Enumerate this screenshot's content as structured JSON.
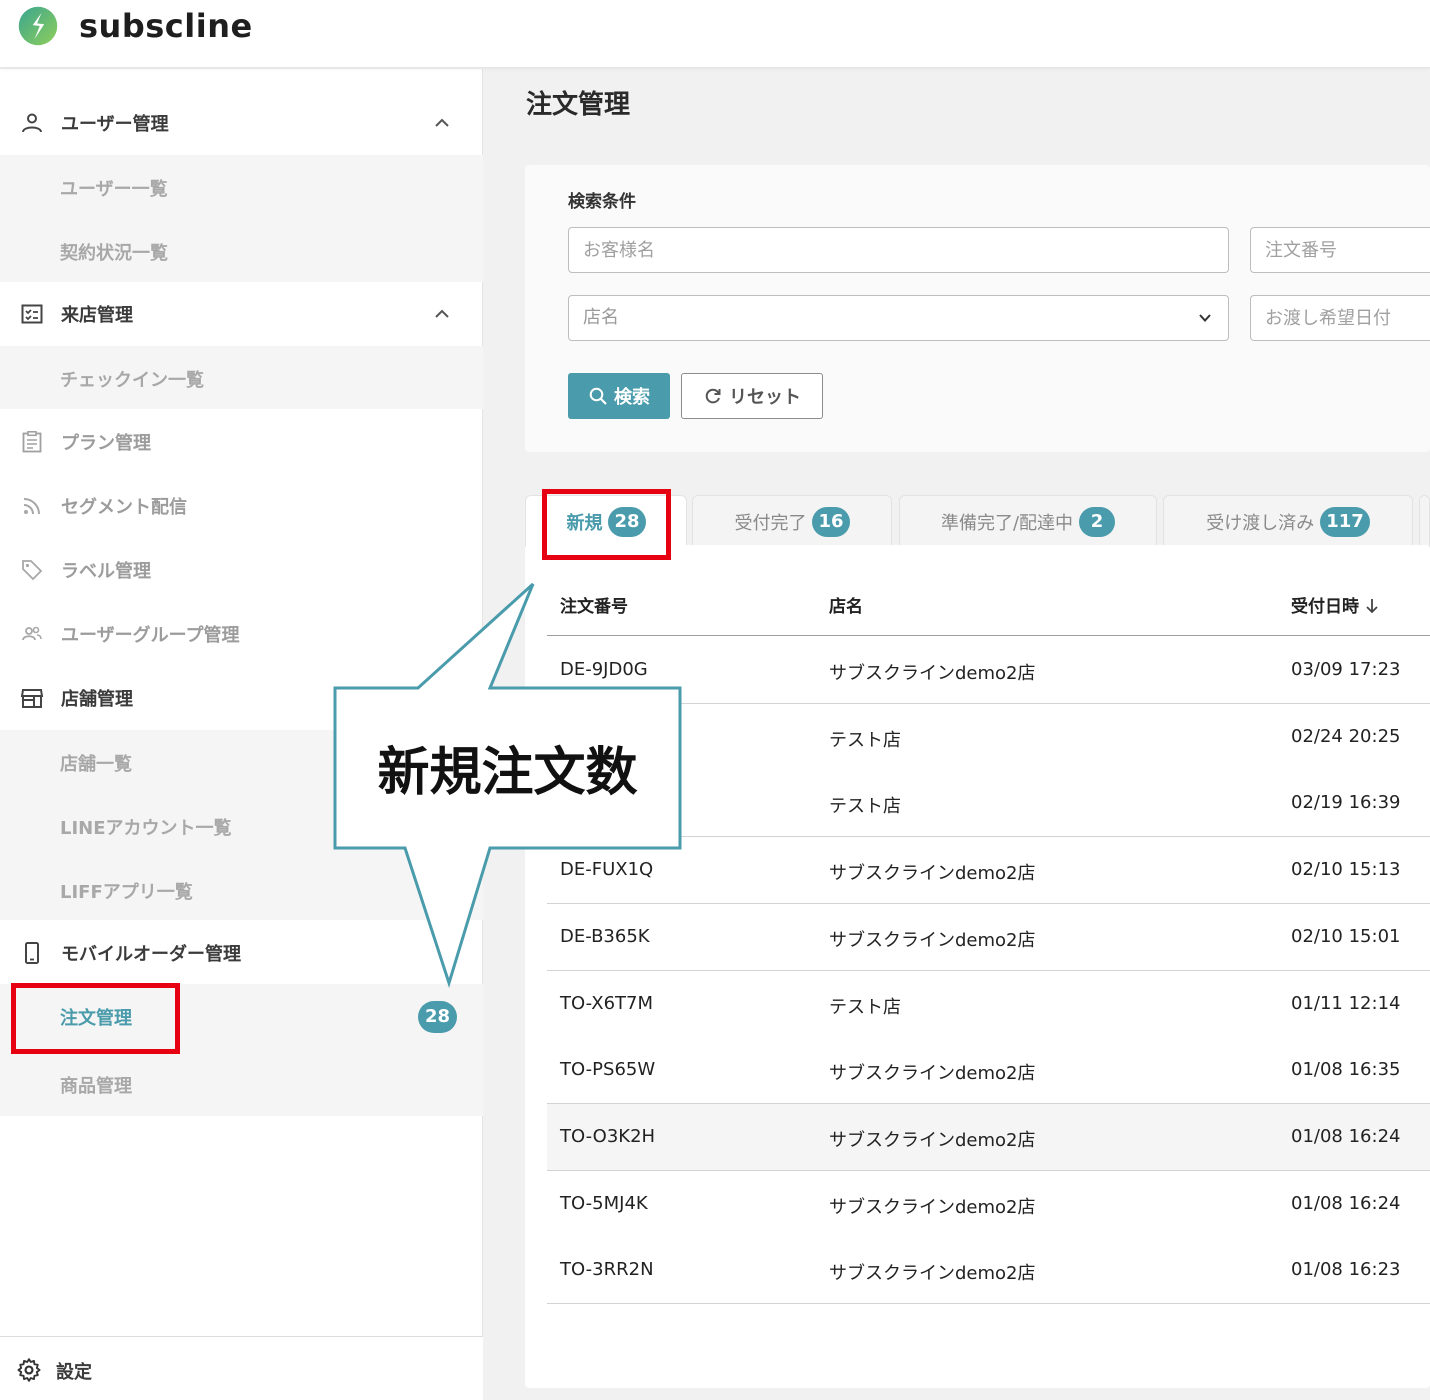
{
  "app": {
    "brand": "subscline",
    "accent_color": "#4a9bab",
    "annotation_color": "#e60012"
  },
  "sidebar": {
    "groups": [
      {
        "label": "ユーザー管理",
        "icon": "person-icon",
        "expanded": true,
        "children": [
          {
            "label": "ユーザー一覧"
          },
          {
            "label": "契約状況一覧"
          }
        ]
      },
      {
        "label": "来店管理",
        "icon": "checklist-icon",
        "expanded": true,
        "children": [
          {
            "label": "チェックイン一覧"
          }
        ]
      },
      {
        "label": "プラン管理",
        "icon": "clipboard-icon"
      },
      {
        "label": "セグメント配信",
        "icon": "rss-icon"
      },
      {
        "label": "ラベル管理",
        "icon": "tag-icon"
      },
      {
        "label": "ユーザーグループ管理",
        "icon": "group-icon"
      },
      {
        "label": "店舗管理",
        "icon": "store-icon",
        "children": [
          {
            "label": "店舗一覧"
          },
          {
            "label": "LINEアカウント一覧"
          },
          {
            "label": "LIFFアプリ一覧"
          }
        ]
      },
      {
        "label": "モバイルオーダー管理",
        "icon": "mobile-icon",
        "children": [
          {
            "label": "注文管理",
            "badge": "28",
            "active": true
          },
          {
            "label": "商品管理"
          }
        ]
      }
    ],
    "footer": {
      "label": "設定",
      "icon": "gear-icon"
    }
  },
  "main": {
    "title": "注文管理",
    "search": {
      "heading": "検索条件",
      "customer_placeholder": "お客様名",
      "order_no_placeholder": "注文番号",
      "store_select_value": "店名",
      "date_placeholder": "お渡し希望日付",
      "search_label": "検索",
      "reset_label": "リセット"
    },
    "tabs": [
      {
        "label": "新規",
        "count": "28",
        "active": true
      },
      {
        "label": "受付完了",
        "count": "16"
      },
      {
        "label": "準備完了/配達中",
        "count": "2"
      },
      {
        "label": "受け渡し済み",
        "count": "117"
      }
    ],
    "table": {
      "columns": [
        "注文番号",
        "店名",
        "受付日時"
      ],
      "rows": [
        [
          "DE-9JD0G",
          "サブスクラインdemo2店",
          "03/09 17:23"
        ],
        [
          "",
          "テスト店",
          "02/24 20:25"
        ],
        [
          "",
          "テスト店",
          "02/19 16:39"
        ],
        [
          "DE-FUX1Q",
          "サブスクラインdemo2店",
          "02/10 15:13"
        ],
        [
          "DE-B365K",
          "サブスクラインdemo2店",
          "02/10 15:01"
        ],
        [
          "TO-X6T7M",
          "テスト店",
          "01/11 12:14"
        ],
        [
          "TO-PS65W",
          "サブスクラインdemo2店",
          "01/08 16:35"
        ],
        [
          "TO-O3K2H",
          "サブスクラインdemo2店",
          "01/08 16:24"
        ],
        [
          "TO-5MJ4K",
          "サブスクラインdemo2店",
          "01/08 16:24"
        ],
        [
          "TO-3RR2N",
          "サブスクラインdemo2店",
          "01/08 16:23"
        ]
      ]
    }
  },
  "annotation": {
    "callout_text": "新規注文数"
  }
}
